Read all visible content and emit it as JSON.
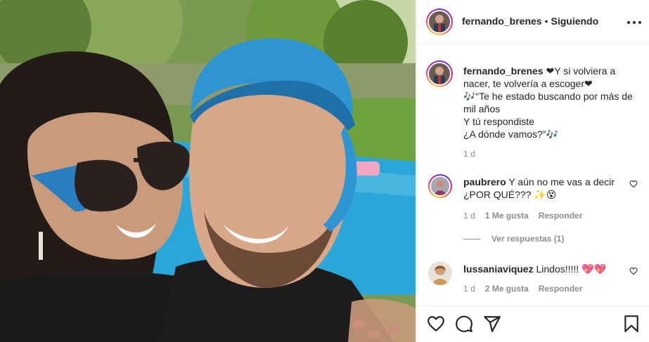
{
  "post": {
    "author": "fernando_brenes",
    "separator": "•",
    "follow_status": "Siguiendo",
    "caption_lines": [
      "❤Y si volviera a nacer, te volvería a escoger❤",
      "🎶“Te he estado buscando por más de mil años",
      "Y tú respondiste",
      "¿A dónde vamos?”🎶"
    ],
    "time": "1 d"
  },
  "comments": [
    {
      "username": "paubrero",
      "text": "Y aún no me vas a decir ¿POR QUÉ??? ✨😵",
      "time": "1 d",
      "likes": "1 Me gusta",
      "reply": "Responder"
    },
    {
      "username": "lussaniaviquez",
      "text": "Lindos!!!!! 💖💖",
      "time": "1 d",
      "likes": "2 Me gusta",
      "reply": "Responder"
    }
  ],
  "view_replies": "Ver respuestas (1)",
  "icons": [
    "more-options-icon",
    "like-heart-icon",
    "comment-icon",
    "share-icon",
    "save-bookmark-icon",
    "comment-like-heart-icon"
  ],
  "colors": {
    "text": "#262626",
    "muted": "#8e8e8e",
    "border": "#efefef",
    "pool": "#2aa6d8",
    "cap": "#2f95d2"
  }
}
